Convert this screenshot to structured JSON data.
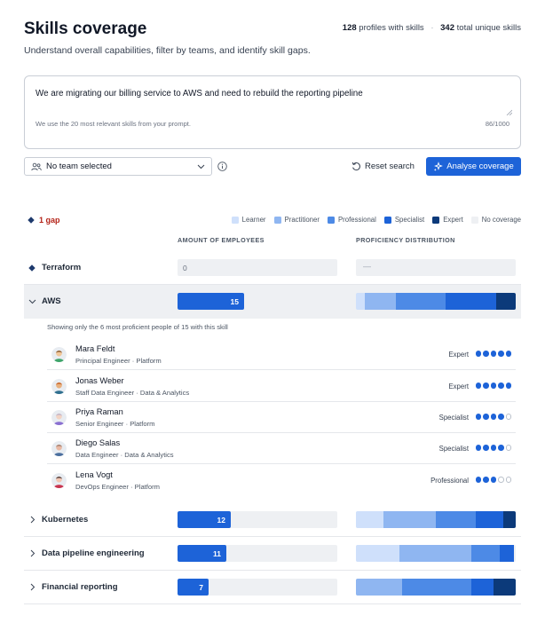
{
  "header": {
    "title": "Skills coverage",
    "subtitle": "Understand overall capabilities, filter by teams, and identify skill gaps.",
    "profiles_count": "128",
    "profiles_label": "profiles with skills",
    "separator": "·",
    "skills_count": "342",
    "skills_label": "total unique skills"
  },
  "prompt": {
    "value": "We are migrating our billing service to AWS and need to rebuild the reporting pipeline",
    "help": "We use the 20 most relevant skills from your prompt.",
    "count": "86/1000"
  },
  "filters": {
    "team_select": "No team selected",
    "reset_label": "Reset search",
    "analyse_label": "Analyse coverage"
  },
  "gaps": {
    "label": "1 gap"
  },
  "legend": [
    {
      "label": "Learner",
      "color": "#cfe0fb"
    },
    {
      "label": "Practitioner",
      "color": "#8fb6f1"
    },
    {
      "label": "Professional",
      "color": "#4d8ae6"
    },
    {
      "label": "Specialist",
      "color": "#1d63d8"
    },
    {
      "label": "Expert",
      "color": "#0c3a7a"
    },
    {
      "label": "No coverage",
      "color": "#eef0f3"
    }
  ],
  "columns": {
    "employees": "AMOUNT OF EMPLOYEES",
    "distribution": "PROFICIENCY DISTRIBUTION"
  },
  "skills": [
    {
      "name": "Terraform",
      "count": 0,
      "count_label": "0",
      "gap": true,
      "empty_label": "—",
      "distribution": []
    },
    {
      "name": "AWS",
      "count": 15,
      "count_label": "15",
      "expanded": true,
      "distribution": [
        0.06,
        0.2,
        0.33,
        0.33,
        0.13
      ]
    },
    {
      "name": "Kubernetes",
      "count": 12,
      "count_label": "12",
      "distribution": [
        0.17,
        0.33,
        0.25,
        0.17,
        0.08
      ]
    },
    {
      "name": "Data pipeline engineering",
      "count": 11,
      "count_label": "11",
      "distribution": [
        0.27,
        0.45,
        0.18,
        0.09,
        0
      ]
    },
    {
      "name": "Financial reporting",
      "count": 7,
      "count_label": "7",
      "distribution": [
        0,
        0.29,
        0.43,
        0.14,
        0.14
      ]
    }
  ],
  "max_count": 36,
  "aws_detail": {
    "note": "Showing only the 6 most proficient people of 15 with this skill",
    "people": [
      {
        "name": "Mara Feldt",
        "role": "Principal Engineer · Platform",
        "level": "Expert",
        "dots": 5,
        "skin": "#f1c79a",
        "shirt": "#3fa56b",
        "hair": "#7a4a1f"
      },
      {
        "name": "Jonas Weber",
        "role": "Staff Data Engineer · Data & Analytics",
        "level": "Expert",
        "dots": 5,
        "skin": "#e8b07e",
        "shirt": "#2f6f8f",
        "hair": "#c2571a"
      },
      {
        "name": "Priya Raman",
        "role": "Senior Engineer · Platform",
        "level": "Specialist",
        "dots": 4,
        "skin": "#f2d3c4",
        "shirt": "#8a6fd1",
        "hair": "#b9b0c9"
      },
      {
        "name": "Diego Salas",
        "role": "Data Engineer · Data & Analytics",
        "level": "Specialist",
        "dots": 4,
        "skin": "#e9b9a5",
        "shirt": "#4b6f9e",
        "hair": "#9a7766"
      },
      {
        "name": "Lena Vogt",
        "role": "DevOps Engineer · Platform",
        "level": "Professional",
        "dots": 3,
        "skin": "#f3c6b3",
        "shirt": "#c8344f",
        "hair": "#3a2a2a"
      }
    ]
  }
}
